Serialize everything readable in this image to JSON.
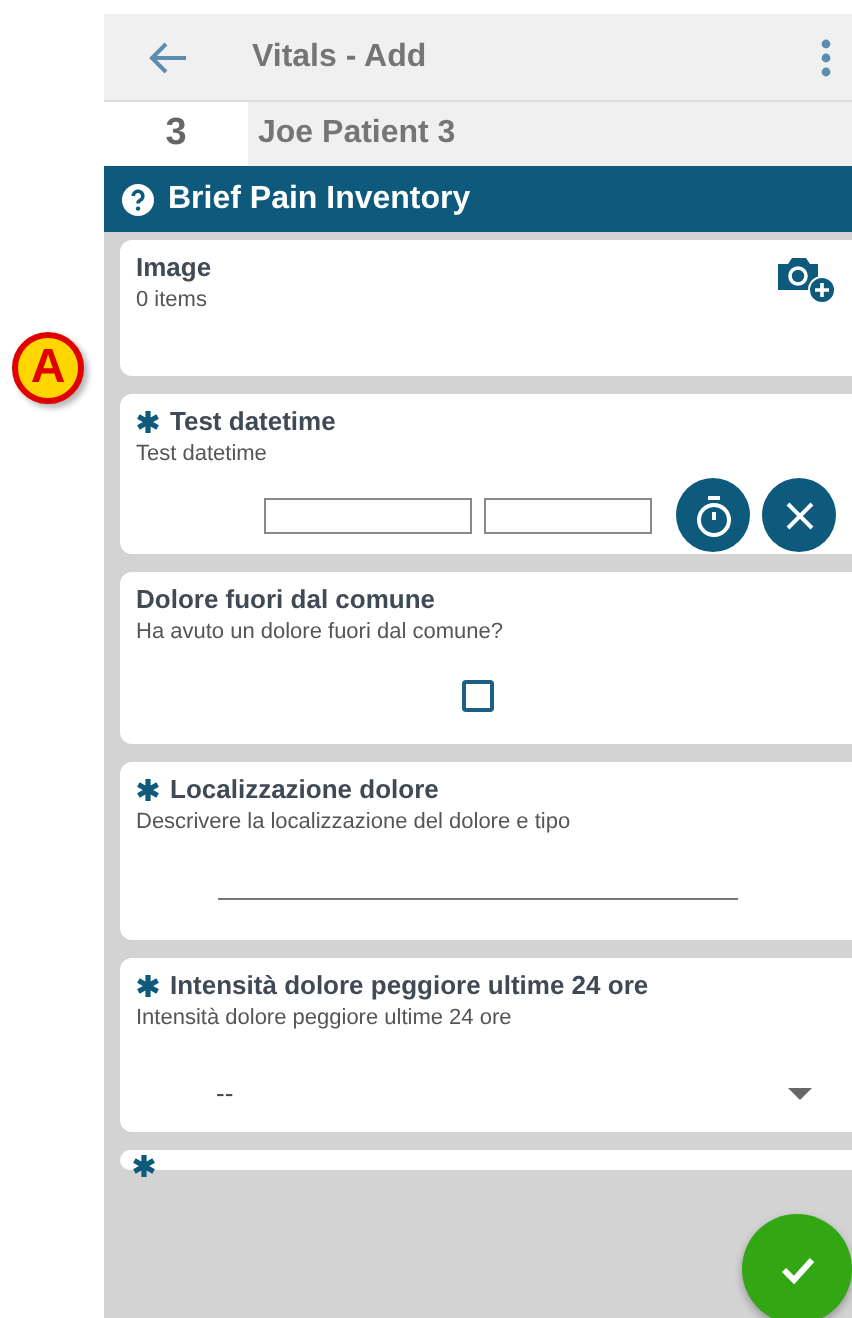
{
  "callout": {
    "label": "A"
  },
  "header": {
    "title": "Vitals - Add"
  },
  "patient": {
    "bed": "3",
    "name": "Joe Patient 3"
  },
  "section": {
    "title": "Brief Pain Inventory"
  },
  "fields": [
    {
      "kind": "image",
      "required": false,
      "label": "Image",
      "description": "0 items"
    },
    {
      "kind": "datetime",
      "required": true,
      "label": "Test datetime",
      "description": "Test datetime"
    },
    {
      "kind": "checkbox",
      "required": false,
      "label": "Dolore fuori dal comune",
      "description": "Ha avuto un dolore fuori dal comune?",
      "checked": false
    },
    {
      "kind": "text",
      "required": true,
      "label": "Localizzazione dolore",
      "description": "Descrivere la localizzazione del dolore e tipo"
    },
    {
      "kind": "select",
      "required": true,
      "label": "Intensità dolore peggiore ultime 24 ore",
      "description": "Intensità dolore peggiore ultime 24 ore",
      "value": "--"
    },
    {
      "kind": "partial",
      "required": true
    }
  ]
}
